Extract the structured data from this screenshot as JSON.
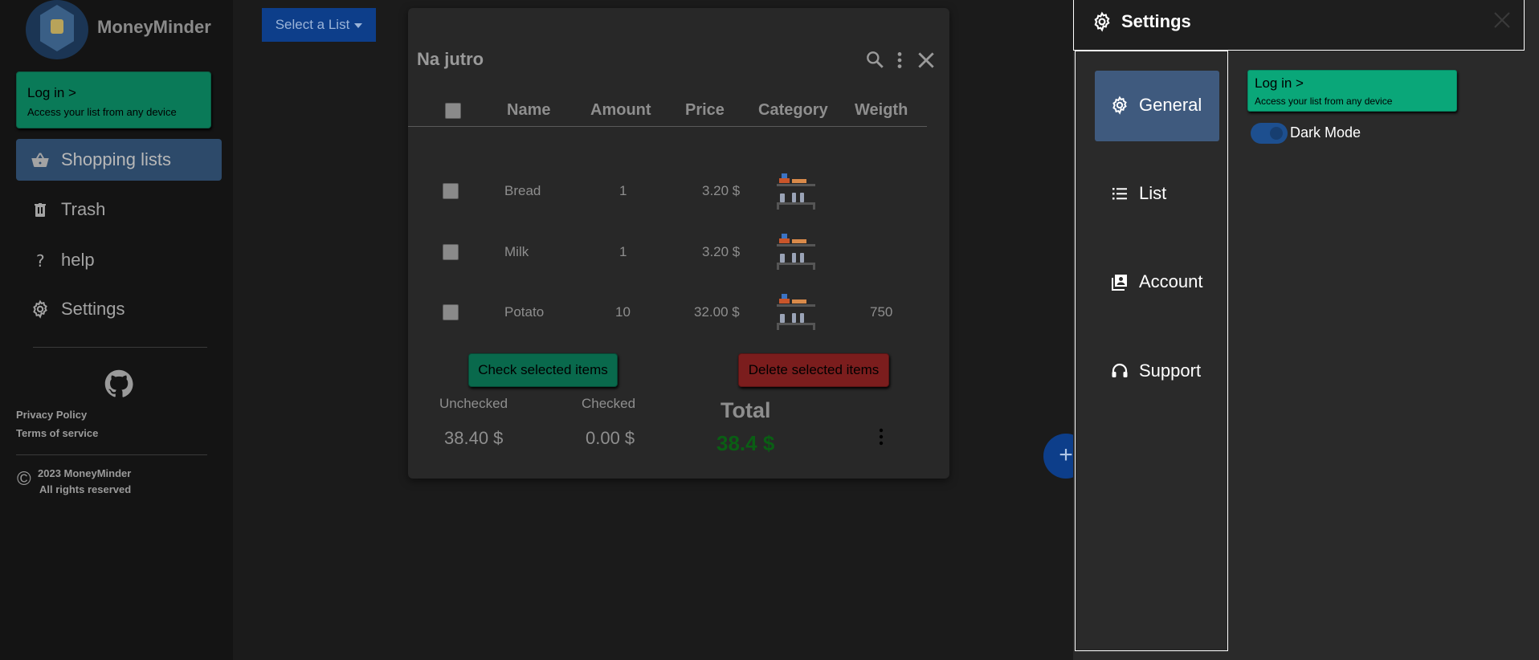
{
  "app": {
    "name": "MoneyMinder"
  },
  "sidebar": {
    "login": {
      "title": "Log in >",
      "subtitle": "Access your list from any device"
    },
    "items": [
      {
        "label": "Shopping lists",
        "icon": "basket-icon"
      },
      {
        "label": "Trash",
        "icon": "trash-icon"
      },
      {
        "label": "help",
        "icon": "question-icon"
      },
      {
        "label": "Settings",
        "icon": "gear-icon"
      }
    ],
    "footer": {
      "privacy": "Privacy Policy",
      "terms": "Terms of service",
      "copyright_line1": "2023 MoneyMinder",
      "copyright_line2": "All rights reserved"
    }
  },
  "toolbar": {
    "select_list_label": "Select a List"
  },
  "list": {
    "title": "Na jutro",
    "columns": [
      "Name",
      "Amount",
      "Price",
      "Category",
      "Weigth"
    ],
    "rows": [
      {
        "name": "Bread",
        "amount": "1",
        "price": "3.20 $",
        "category_icon": "grocery-shelf-icon",
        "weight": ""
      },
      {
        "name": "Milk",
        "amount": "1",
        "price": "3.20 $",
        "category_icon": "grocery-shelf-icon",
        "weight": ""
      },
      {
        "name": "Potato",
        "amount": "10",
        "price": "32.00 $",
        "category_icon": "grocery-shelf-icon",
        "weight": "750"
      }
    ],
    "check_button": "Check selected items",
    "delete_button": "Delete selected items",
    "summary": {
      "unchecked_label": "Unchecked",
      "unchecked_value": "38.40 $",
      "checked_label": "Checked",
      "checked_value": "0.00 $",
      "total_label": "Total",
      "total_value": "38.4 $"
    }
  },
  "fab": {
    "label": "+"
  },
  "settings": {
    "title": "Settings",
    "nav": [
      {
        "label": "General",
        "icon": "gear-icon",
        "active": true
      },
      {
        "label": "List",
        "icon": "list-icon",
        "active": false
      },
      {
        "label": "Account",
        "icon": "account-box-icon",
        "active": false
      },
      {
        "label": "Support",
        "icon": "headset-icon",
        "active": false
      }
    ],
    "login": {
      "title": "Log in >",
      "subtitle": "Access your list from any device"
    },
    "dark_mode_label": "Dark Mode",
    "dark_mode_on": true
  },
  "colors": {
    "accent_blue": "#0d3e8a",
    "active_nav": "#2d4a6a",
    "login_green": "#0aa779",
    "delete_red": "#7b1d1d",
    "total_green": "#0a5e14"
  }
}
